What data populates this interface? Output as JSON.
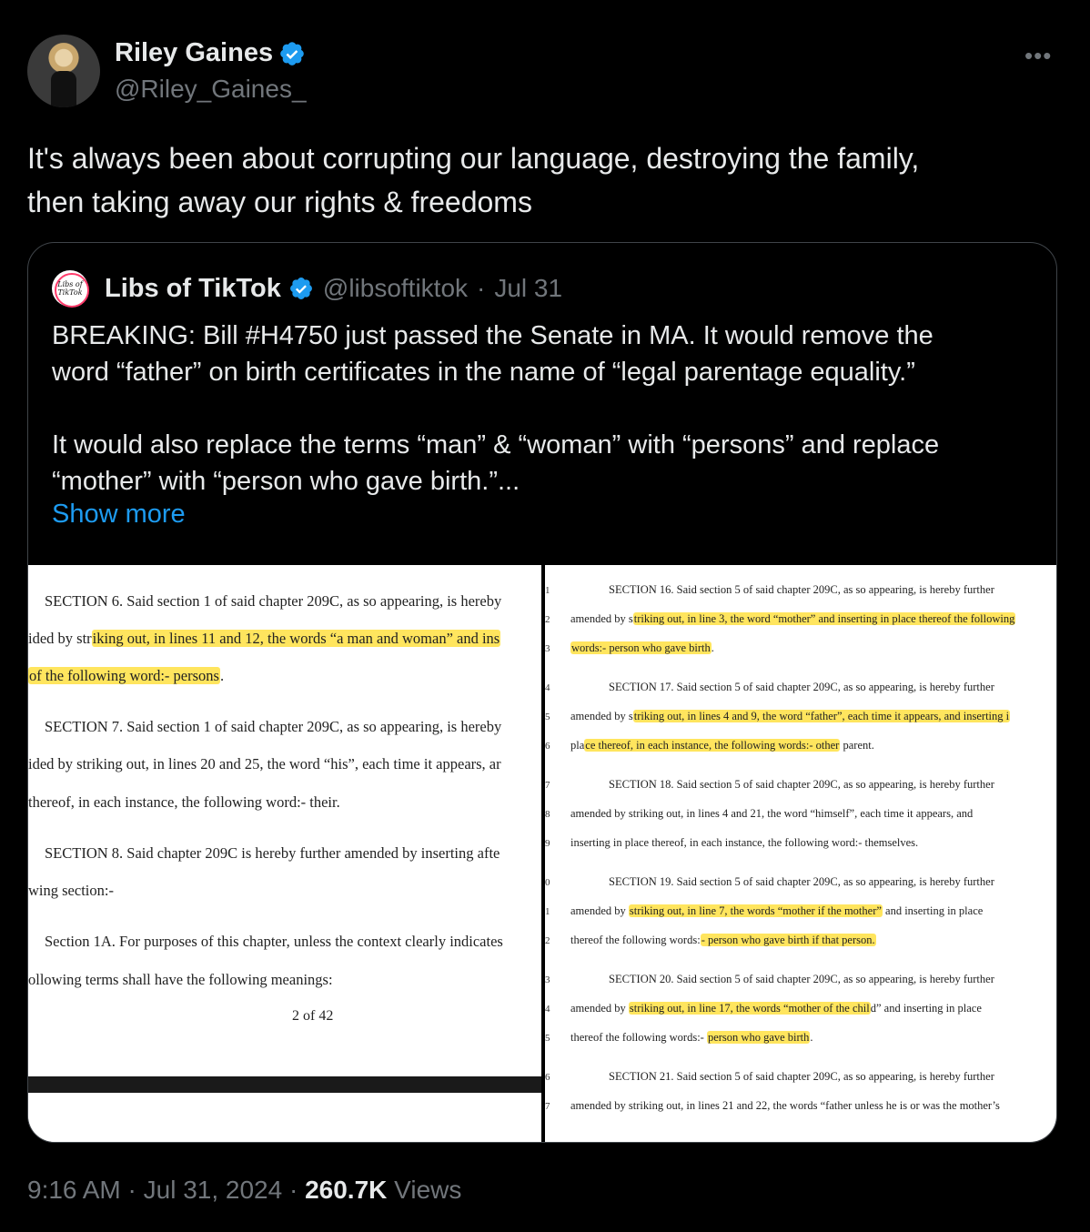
{
  "author": {
    "name": "Riley Gaines",
    "handle": "@Riley_Gaines_",
    "more_icon": "more-horizontal-icon",
    "verified_color": "#1d9bf0"
  },
  "tweet": {
    "text_line1": "It's always been about corrupting our language, destroying the family,",
    "text_line2": "then taking away our rights & freedoms"
  },
  "quote": {
    "avatar_text": "Libs of TikTok",
    "name": "Libs of TikTok",
    "handle": "@libsoftiktok",
    "separator": "·",
    "date": "Jul 31",
    "para1_line1": "BREAKING: Bill #H4750 just passed the Senate in MA. It would remove the",
    "para1_line2": "word “father” on birth certificates in the name of “legal parentage equality.”",
    "para2_line1": "It would also replace the terms “man” & “woman” with “persons” and replace",
    "para2_line2": "“mother” with “person who gave birth.”...",
    "show_more": "Show more"
  },
  "doc_left": {
    "l1": "SECTION 6. Said section 1 of said chapter 209C, as so appearing, is hereby",
    "l2a": "ided by str",
    "l2b": "iking out, in lines 11 and 12, the words “a man and woman” and ins",
    "l3": "of the following word:- persons",
    "l3b": ".",
    "l4": "SECTION 7. Said section 1 of said chapter 209C, as so appearing, is hereby",
    "l5": "ided by striking out, in lines 20 and 25, the word “his”, each time it appears, ar",
    "l6": " thereof, in each instance, the following word:- their.",
    "l7": "SECTION 8. Said chapter 209C is hereby further amended by inserting afte",
    "l8": "wing section:-",
    "l9": "Section 1A. For purposes of this chapter, unless the context clearly indicates",
    "l10": "ollowing terms shall have the following meanings:",
    "page": "2 of 42"
  },
  "doc_right": {
    "nums": [
      "1",
      "2",
      "3",
      "4",
      "5",
      "6",
      "7",
      "8",
      "9",
      "0",
      "1",
      "2",
      "3",
      "4",
      "5",
      "6",
      "7"
    ],
    "r1": "SECTION 16. Said section 5 of said chapter 209C, as so appearing, is hereby further",
    "r2a": "amended by s",
    "r2b": "triking out, in line 3, the word “mother” and inserting in place thereof the following",
    "r3": "words:- person who gave birth",
    "r3b": ".",
    "r4": "SECTION 17. Said section 5 of said chapter 209C, as so appearing, is hereby further",
    "r5a": "amended by s",
    "r5b": "triking out, in lines 4 and 9, the word “father”, each time it appears, and inserting i",
    "r6a": "pla",
    "r6b": "ce thereof, in each instance, the following words:- other",
    "r6c": " parent.",
    "r7": "SECTION 18. Said section 5 of said chapter 209C, as so appearing, is hereby further",
    "r8": "amended by striking out, in lines 4 and 21, the word “himself”, each time it appears, and",
    "r9": "inserting in place thereof, in each instance, the following word:- themselves.",
    "r10": "SECTION 19. Said section 5 of said chapter 209C, as so appearing, is hereby further",
    "r11a": "amended by ",
    "r11b": "striking out, in line 7, the words “mother if the mother”",
    "r11c": " and inserting in place",
    "r12a": "thereof the following words:",
    "r12b": "- person who gave birth if that person.",
    "r13": "SECTION 20. Said section 5 of said chapter 209C, as so appearing, is hereby further",
    "r14a": "amended by ",
    "r14b": "striking out, in line 17, the words “mother of the chil",
    "r14c": "d” and inserting in place",
    "r15a": "thereof the following words:- ",
    "r15b": "person who gave birth",
    "r15c": ".",
    "r16": "SECTION 21. Said section 5 of said chapter 209C, as so appearing, is hereby further",
    "r17": "amended by striking out, in lines 21 and 22, the words “father unless he is or was the mother’s"
  },
  "footer": {
    "time": "9:16 AM",
    "sep1": "·",
    "date": "Jul 31, 2024",
    "sep2": "·",
    "views_count": "260.7K",
    "views_label": "Views"
  }
}
